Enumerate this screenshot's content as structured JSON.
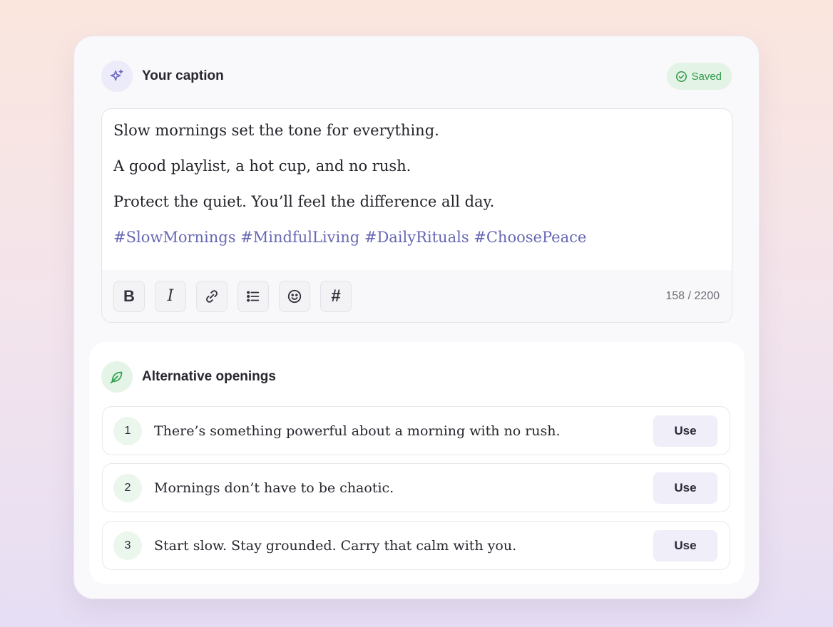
{
  "caption": {
    "title": "Your caption",
    "status_label": "Saved",
    "lines": [
      "Slow mornings set the tone for everything.",
      "A good playlist, a hot cup, and no rush.",
      "Protect the quiet. You’ll feel the difference all day."
    ],
    "hashtags": "#SlowMornings #MindfulLiving #DailyRituals #ChoosePeace",
    "toolbar": {
      "bold_label": "B",
      "italic_label": "I",
      "hashtag_label": "#",
      "char_count": "158 / 2200"
    }
  },
  "alternatives": {
    "title": "Alternative openings",
    "use_label": "Use",
    "items": [
      {
        "number": "1",
        "text": "There’s something powerful about a morning with no rush."
      },
      {
        "number": "2",
        "text": "Mornings don’t have to be chaotic."
      },
      {
        "number": "3",
        "text": "Start slow. Stay grounded. Carry that calm with you."
      }
    ]
  },
  "icons": {
    "header": "sparkles-icon",
    "status": "check-circle-icon",
    "toolbar": [
      "bold-icon",
      "italic-icon",
      "link-icon",
      "list-icon",
      "emoji-icon",
      "hashtag-icon"
    ],
    "alternatives": "leaf-icon"
  },
  "colors": {
    "accent_purple": "#6667b4",
    "success_green": "#2f9a4a",
    "badge_green_bg": "#e3f3e5"
  }
}
